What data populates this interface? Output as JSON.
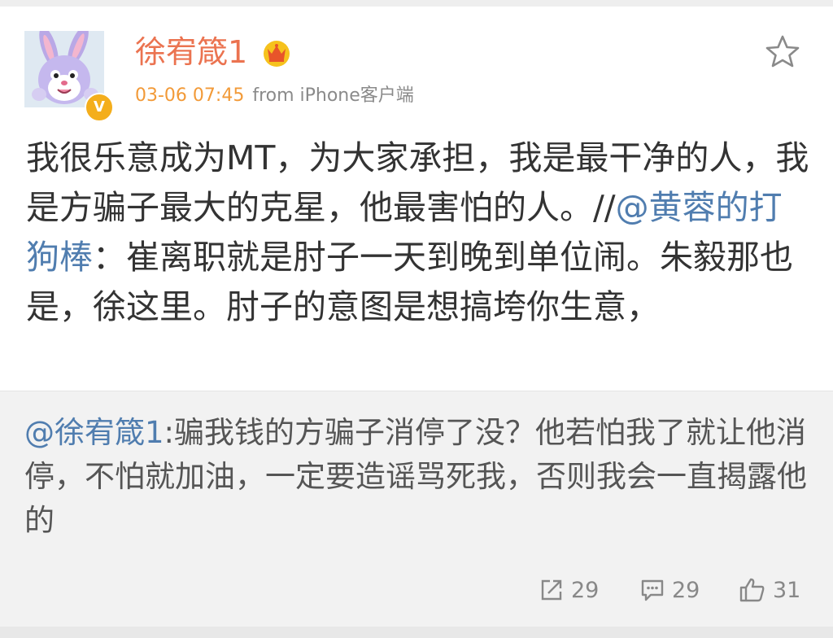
{
  "post": {
    "author": "徐宥箴1",
    "time": "03-06 07:45",
    "source": "from iPhone客户端",
    "verified_badge": "V",
    "icons": {
      "avatar": "rabbit-avatar",
      "vip": "crown-icon",
      "favorite": "star-icon"
    },
    "text_1": "我很乐意成为MT，为大家承担，我是最干净的人，我是方骗子最大的克星，他最害怕的人。//",
    "mention_1": "@黄蓉的打狗棒",
    "text_2": "：崔离职就是肘子一天到晚到单位闹。朱毅那也是，徐这里。肘子的意图是想搞垮你生意，"
  },
  "repost": {
    "mention": "@徐宥箴1",
    "text": ":骗我钱的方骗子消停了没？他若怕我了就让他消停，不怕就加油，一定要造谣骂死我，否则我会一直揭露他的"
  },
  "actions": {
    "repost_count": "29",
    "comment_count": "29",
    "like_count": "31",
    "icons": {
      "repost": "share-icon",
      "comment": "comment-icon",
      "like": "thumbs-up-icon"
    }
  },
  "colors": {
    "name": "#eb7350",
    "time": "#f29a38",
    "mention": "#507daf",
    "repost_bg": "#f2f2f2",
    "badge": "#f4ae1c"
  }
}
